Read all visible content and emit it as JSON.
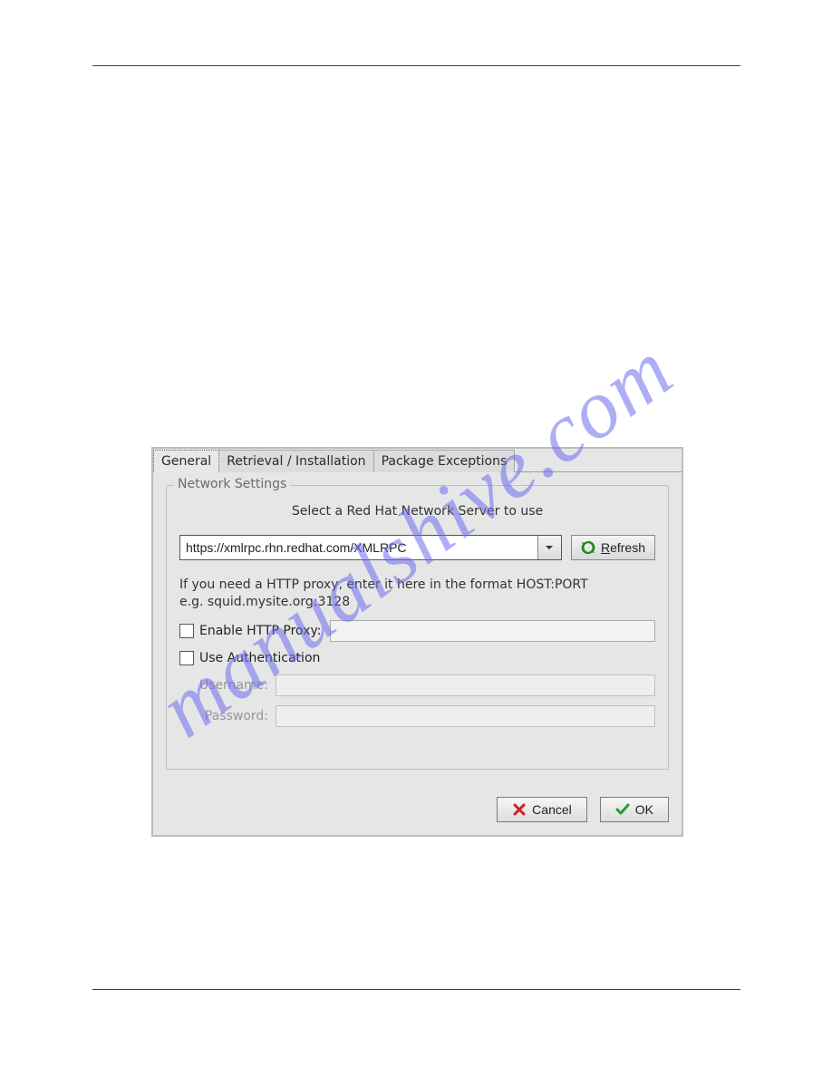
{
  "watermark": "manualshive.com",
  "tabs": {
    "general": "General",
    "retrieval": "Retrieval / Installation",
    "exceptions": "Package Exceptions"
  },
  "fieldset": {
    "legend": "Network Settings",
    "select_label": "Select a Red Hat Network Server to use",
    "server_value": "https://xmlrpc.rhn.redhat.com/XMLRPC",
    "refresh_label_pre": "R",
    "refresh_label_post": "efresh",
    "proxy_help_line1": "If you need a HTTP proxy, enter it here in the format HOST:PORT",
    "proxy_help_line2": "e.g. squid.mysite.org:3128",
    "enable_proxy_label": "Enable HTTP Proxy:",
    "use_auth_label": "Use Authentication",
    "username_label": "Username:",
    "password_label": "Password:"
  },
  "buttons": {
    "cancel_pre": "C",
    "cancel_post": "ancel",
    "ok_pre": "O",
    "ok_post": "K"
  }
}
